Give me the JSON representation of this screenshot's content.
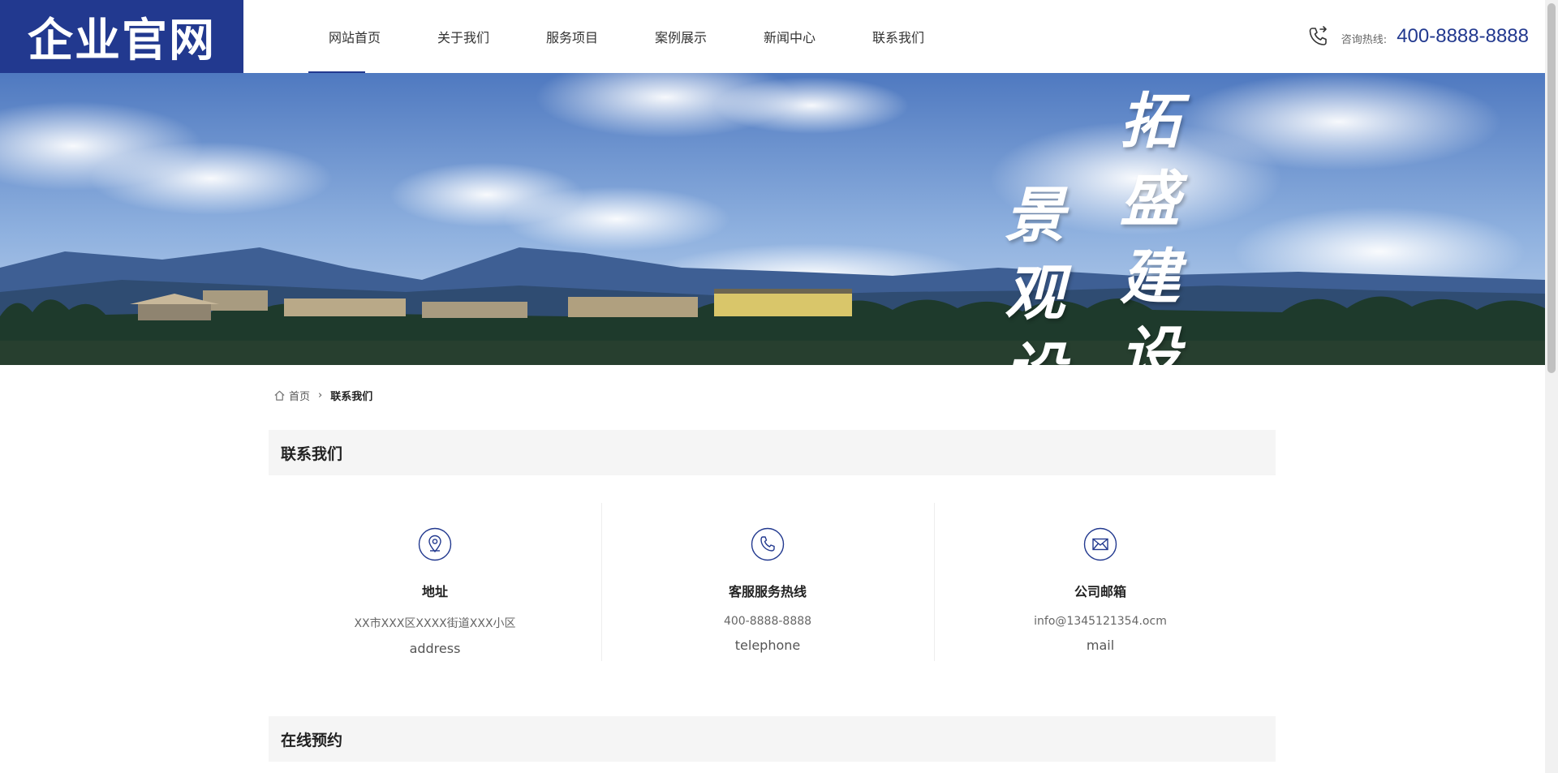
{
  "header": {
    "logo_text": "企业官网",
    "nav": [
      "网站首页",
      "关于我们",
      "服务项目",
      "案例展示",
      "新闻中心",
      "联系我们"
    ],
    "hotline_label": "咨询热线:",
    "hotline_number": "400-8888-8888"
  },
  "banner": {
    "calligraphy_right": "拓盛建设",
    "calligraphy_left": "景观设计"
  },
  "breadcrumb": {
    "home": "首页",
    "current": "联系我们"
  },
  "contact": {
    "heading": "联系我们",
    "cards": [
      {
        "title": "地址",
        "value": "XX市XXX区XXXX街道XXX小区",
        "en": "address",
        "icon": "location-pin-icon"
      },
      {
        "title": "客服服务热线",
        "value": "400-8888-8888",
        "en": "telephone",
        "icon": "phone-icon"
      },
      {
        "title": "公司邮箱",
        "value": "info@1345121354.ocm",
        "en": "mail",
        "icon": "envelope-icon"
      }
    ]
  },
  "booking": {
    "heading": "在线预约"
  },
  "colors": {
    "brand": "#22398f",
    "section_bg": "#f5f5f5"
  }
}
